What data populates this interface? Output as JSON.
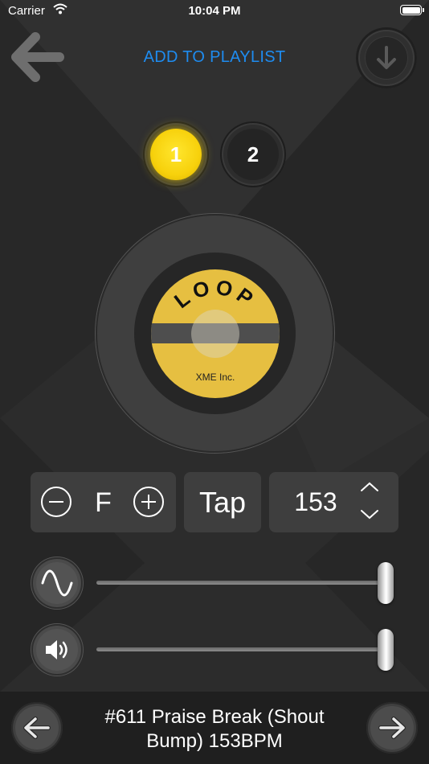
{
  "status_bar": {
    "carrier": "Carrier",
    "time": "10:04 PM"
  },
  "header": {
    "add_to_playlist": "ADD TO PLAYLIST"
  },
  "tabs": [
    {
      "label": "1",
      "active": true
    },
    {
      "label": "2",
      "active": false
    }
  ],
  "record": {
    "title": "LOOP",
    "maker": "XME Inc."
  },
  "controls": {
    "key": "F",
    "tap_label": "Tap",
    "bpm": "153"
  },
  "sliders": [
    {
      "name": "wave",
      "icon": "sine-wave-icon",
      "value": 1.0
    },
    {
      "name": "volume",
      "icon": "speaker-icon",
      "value": 1.0
    }
  ],
  "now_playing": {
    "title": "#611 Praise Break (Shout Bump) 153BPM"
  },
  "colors": {
    "accent_blue": "#1e8cf0",
    "active_yellow": "#f7d10c",
    "label_gold": "#e6bf41"
  }
}
